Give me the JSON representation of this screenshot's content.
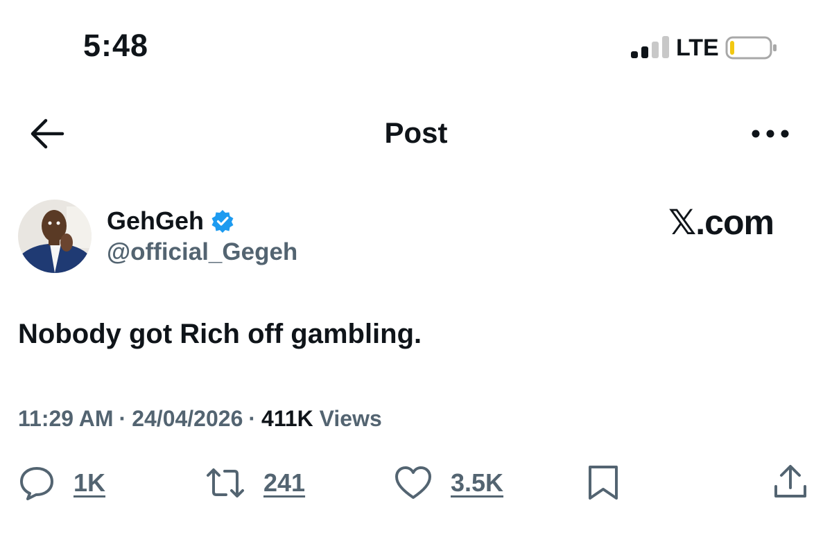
{
  "status_bar": {
    "time": "5:48",
    "network": "LTE",
    "signal_bars": 2,
    "battery_level": 0.1
  },
  "nav": {
    "title": "Post",
    "back_icon": "arrow-left-icon",
    "more_icon": "ellipsis-icon"
  },
  "author": {
    "name": "GehGeh",
    "handle": "@official_Gegeh",
    "verified": true
  },
  "watermark": "𝕏.com",
  "post": {
    "text": "Nobody got Rich off gambling.",
    "time": "11:29 AM",
    "date": "24/04/2026",
    "separator": "·",
    "views_count": "411K",
    "views_label": "Views"
  },
  "actions": {
    "replies": "1K",
    "reposts": "241",
    "likes": "3.5K"
  },
  "colors": {
    "text": "#0f1419",
    "secondary": "#536471",
    "verified": "#1d9bf0",
    "battery_low": "#f2c811"
  }
}
